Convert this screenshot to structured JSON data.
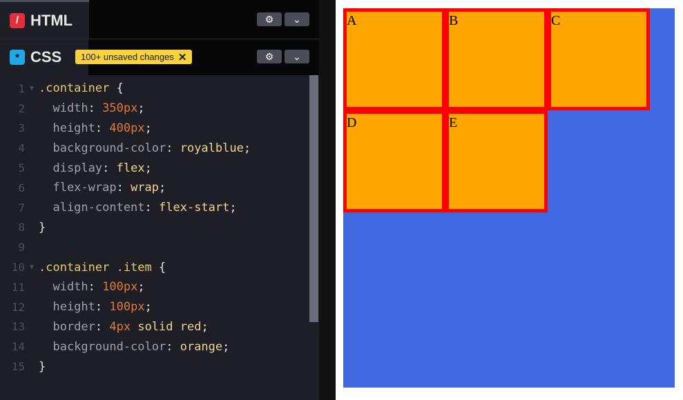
{
  "panels": {
    "html": {
      "label": "HTML",
      "icon": "/"
    },
    "css": {
      "label": "CSS",
      "icon": "*",
      "badge": "100+ unsaved changes"
    }
  },
  "code_lines": [
    {
      "n": "1",
      "tokens": [
        {
          "t": ".container",
          "c": "sel"
        },
        {
          "t": " {",
          "c": "punc"
        }
      ],
      "fold": true
    },
    {
      "n": "2",
      "tokens": [
        {
          "t": "  width",
          "c": "prop"
        },
        {
          "t": ": ",
          "c": "punc"
        },
        {
          "t": "350px",
          "c": "num"
        },
        {
          "t": ";",
          "c": "punc"
        }
      ]
    },
    {
      "n": "3",
      "tokens": [
        {
          "t": "  height",
          "c": "prop"
        },
        {
          "t": ": ",
          "c": "punc"
        },
        {
          "t": "400px",
          "c": "num"
        },
        {
          "t": ";",
          "c": "punc"
        }
      ]
    },
    {
      "n": "4",
      "tokens": [
        {
          "t": "  background-color",
          "c": "prop"
        },
        {
          "t": ": ",
          "c": "punc"
        },
        {
          "t": "royalblue",
          "c": "kw"
        },
        {
          "t": ";",
          "c": "punc"
        }
      ]
    },
    {
      "n": "5",
      "tokens": [
        {
          "t": "  display",
          "c": "prop"
        },
        {
          "t": ": ",
          "c": "punc"
        },
        {
          "t": "flex",
          "c": "kw"
        },
        {
          "t": ";",
          "c": "punc"
        }
      ]
    },
    {
      "n": "6",
      "tokens": [
        {
          "t": "  flex-wrap",
          "c": "prop"
        },
        {
          "t": ": ",
          "c": "punc"
        },
        {
          "t": "wrap",
          "c": "kw"
        },
        {
          "t": ";",
          "c": "punc"
        }
      ]
    },
    {
      "n": "7",
      "tokens": [
        {
          "t": "  align-content",
          "c": "prop"
        },
        {
          "t": ": ",
          "c": "punc"
        },
        {
          "t": "flex-start",
          "c": "kw"
        },
        {
          "t": ";",
          "c": "punc"
        }
      ]
    },
    {
      "n": "8",
      "tokens": [
        {
          "t": "}",
          "c": "punc"
        }
      ]
    },
    {
      "n": "9",
      "tokens": []
    },
    {
      "n": "10",
      "tokens": [
        {
          "t": ".container .item",
          "c": "sel"
        },
        {
          "t": " {",
          "c": "punc"
        }
      ],
      "fold": true
    },
    {
      "n": "11",
      "tokens": [
        {
          "t": "  width",
          "c": "prop"
        },
        {
          "t": ": ",
          "c": "punc"
        },
        {
          "t": "100px",
          "c": "num"
        },
        {
          "t": ";",
          "c": "punc"
        }
      ]
    },
    {
      "n": "12",
      "tokens": [
        {
          "t": "  height",
          "c": "prop"
        },
        {
          "t": ": ",
          "c": "punc"
        },
        {
          "t": "100px",
          "c": "num"
        },
        {
          "t": ";",
          "c": "punc"
        }
      ]
    },
    {
      "n": "13",
      "tokens": [
        {
          "t": "  border",
          "c": "prop"
        },
        {
          "t": ": ",
          "c": "punc"
        },
        {
          "t": "4px",
          "c": "num"
        },
        {
          "t": " solid red",
          "c": "kw"
        },
        {
          "t": ";",
          "c": "punc"
        }
      ]
    },
    {
      "n": "14",
      "tokens": [
        {
          "t": "  background-color",
          "c": "prop"
        },
        {
          "t": ": ",
          "c": "punc"
        },
        {
          "t": "orange",
          "c": "kw"
        },
        {
          "t": ";",
          "c": "punc"
        }
      ]
    },
    {
      "n": "15",
      "tokens": [
        {
          "t": "}",
          "c": "punc"
        }
      ]
    }
  ],
  "preview": {
    "items": [
      "A",
      "B",
      "C",
      "D",
      "E"
    ],
    "container_color": "#4169e1",
    "item_color": "#ffa500",
    "border_color": "#ff0000"
  }
}
